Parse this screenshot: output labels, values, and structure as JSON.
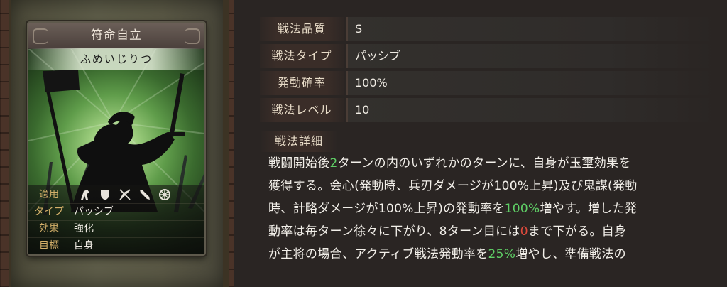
{
  "card": {
    "title": "符命自立",
    "reading": "ふめいじりつ",
    "applicable_label": "適用",
    "applicable_icons": [
      "cavalry-icon",
      "shield-icon",
      "crossbow-icon",
      "spear-icon",
      "siege-icon"
    ],
    "type_label": "タイプ",
    "type_value": "パッシブ",
    "effect_label": "効果",
    "effect_value": "強化",
    "target_label": "目標",
    "target_value": "自身"
  },
  "stats": [
    {
      "label": "戦法品質",
      "value": "S"
    },
    {
      "label": "戦法タイプ",
      "value": "パッシブ"
    },
    {
      "label": "発動確率",
      "value": "100%"
    },
    {
      "label": "戦法レベル",
      "value": "10"
    }
  ],
  "detail": {
    "title": "戦法詳細",
    "line1": {
      "a": "戦闘開始後",
      "b": "2",
      "c": "ターンの内のいずれかのターンに、自身が玉璽効果を"
    },
    "line2": "獲得する。会心(発動時、兵刃ダメージが100%上昇)及び鬼謀(発動",
    "line3": {
      "a": "時、計略ダメージが100%上昇)の発動率を",
      "b": "100%",
      "c": "増やす。増した発"
    },
    "line4": {
      "a": "動率は毎ターン徐々に下がり、8ターン目には",
      "b": "0",
      "c": "まで下がる。自身"
    },
    "line5": {
      "a": "が主将の場合、アクティブ戦法発動率を",
      "b": "25%",
      "c": "増やし、準備戦法の"
    }
  },
  "colors": {
    "highlight_green": "#5fcf66",
    "highlight_red": "#e04a3c",
    "label_gold": "#d4b06a"
  }
}
